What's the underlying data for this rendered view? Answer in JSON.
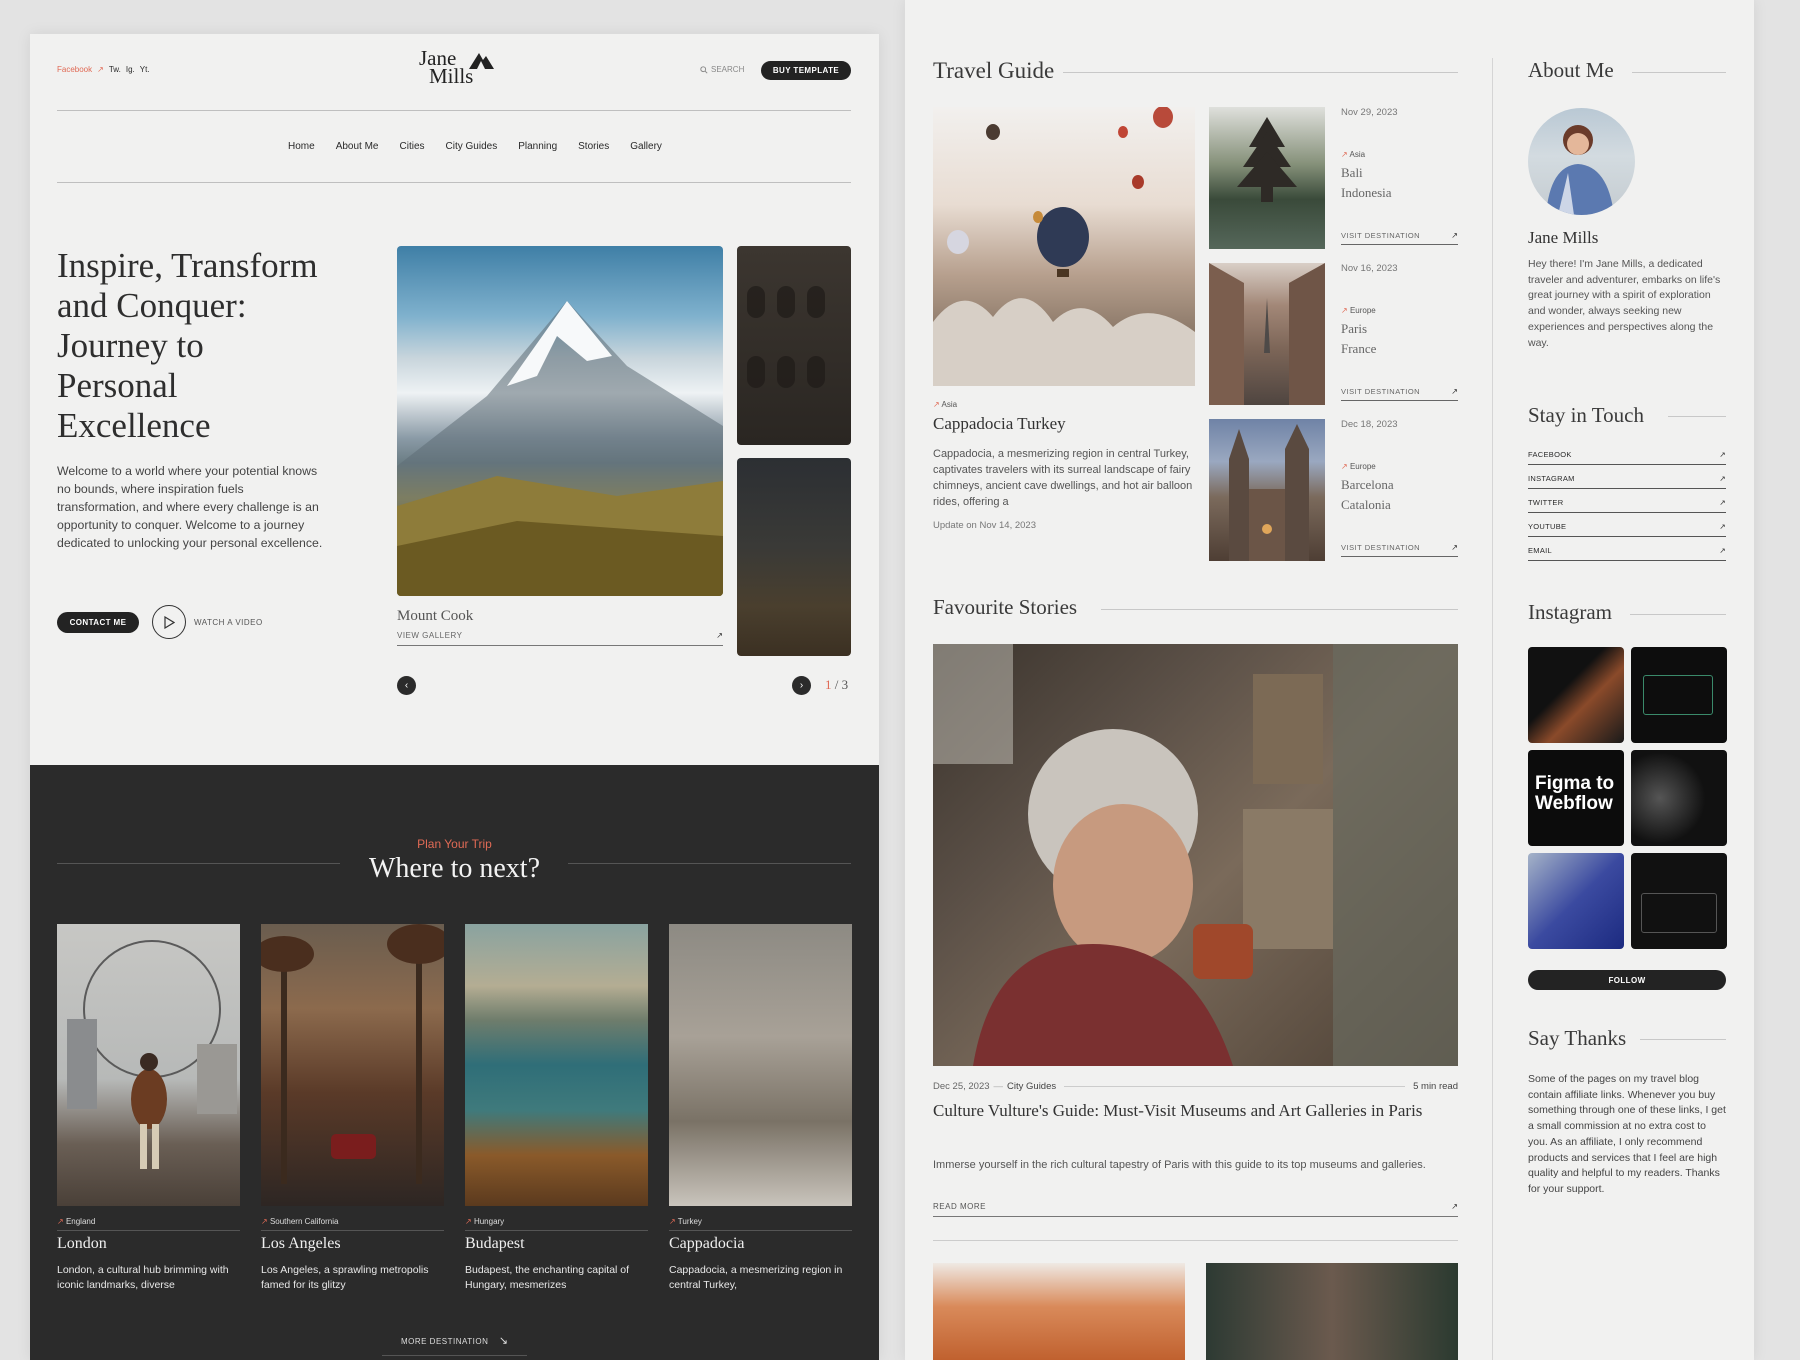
{
  "left": {
    "header": {
      "social": [
        "Facebook",
        "Tw.",
        "Ig.",
        "Yt."
      ],
      "logo_line1": "Jane",
      "logo_line2": "Mills",
      "search": "SEARCH",
      "buy": "BUY TEMPLATE"
    },
    "nav": [
      "Home",
      "About Me",
      "Cities",
      "City Guides",
      "Planning",
      "Stories",
      "Gallery"
    ],
    "hero": {
      "title_lines": [
        "Inspire, Transform",
        "and Conquer:",
        "Journey to",
        "Personal",
        "Excellence"
      ],
      "body": "Welcome to a world where your potential knows no bounds, where inspiration fuels transformation, and where every challenge is an opportunity to conquer. Welcome to a journey dedicated to unlocking your personal excellence.",
      "contact": "CONTACT ME",
      "watch": "WATCH A VIDEO",
      "caption": "Mount Cook",
      "gallery": "VIEW GALLERY",
      "page_current": "1",
      "page_sep": "/",
      "page_total": "3"
    },
    "trip": {
      "eyebrow": "Plan Your Trip",
      "title": "Where to next?",
      "cards": [
        {
          "region": "England",
          "city": "London",
          "desc": "London, a cultural hub brimming with iconic landmarks, diverse"
        },
        {
          "region": "Southern California",
          "city": "Los Angeles",
          "desc": "Los Angeles, a sprawling metropolis famed for its glitzy"
        },
        {
          "region": "Hungary",
          "city": "Budapest",
          "desc": "Budapest, the enchanting capital of Hungary, mesmerizes"
        },
        {
          "region": "Turkey",
          "city": "Cappadocia",
          "desc": "Cappadocia, a mesmerizing region in central Turkey,"
        }
      ],
      "more": "MORE DESTINATION"
    }
  },
  "right": {
    "guide": {
      "title": "Travel Guide",
      "main": {
        "region": "Asia",
        "title": "Cappadocia Turkey",
        "body": "Cappadocia, a mesmerizing region in central Turkey, captivates travelers with its surreal landscape of fairy chimneys, ancient cave dwellings, and hot air balloon rides, offering a",
        "update": "Update on Nov 14, 2023"
      },
      "items": [
        {
          "date": "Nov 29, 2023",
          "region": "Asia",
          "place": "Bali",
          "country": "Indonesia",
          "link": "VISIT DESTINATION"
        },
        {
          "date": "Nov 16, 2023",
          "region": "Europe",
          "place": "Paris",
          "country": "France",
          "link": "VISIT DESTINATION"
        },
        {
          "date": "Dec 18, 2023",
          "region": "Europe",
          "place": "Barcelona",
          "country": "Catalonia",
          "link": "VISIT DESTINATION"
        }
      ]
    },
    "stories": {
      "title": "Favourite Stories",
      "date": "Dec 25, 2023",
      "sep": "—",
      "category": "City Guides",
      "read_time": "5 min read",
      "headline": "Culture Vulture's Guide: Must-Visit Museums and Art Galleries in Paris",
      "excerpt": "Immerse yourself in the rich cultural tapestry of Paris with this guide to its top museums and galleries.",
      "read_more": "READ MORE"
    },
    "sidebar": {
      "about_title": "About Me",
      "name": "Jane Mills",
      "bio": "Hey there! I'm Jane Mills, a dedicated traveler and adventurer, embarks on life's great journey with a spirit of exploration and wonder, always seeking new experiences and perspectives along the way.",
      "touch_title": "Stay in Touch",
      "links": [
        "FACEBOOK",
        "INSTAGRAM",
        "TWITTER",
        "YOUTUBE",
        "EMAIL"
      ],
      "insta_title": "Instagram",
      "insta_tile_text_1": "Figma to",
      "insta_tile_text_2": "Webflow",
      "follow": "FOLLOW",
      "thanks_title": "Say Thanks",
      "thanks_body": "Some of the pages on my travel blog contain affiliate links. Whenever you buy something through one of these links, I get a small commission at no extra cost to you. As an affiliate, I only recommend products and services that I feel are high quality and helpful to my readers. Thanks for your support."
    }
  },
  "colors": {
    "accent": "#e06a55",
    "dark": "#2b2b2b",
    "panel": "#f1f1f0"
  },
  "icons": [
    "arrow-up-right-icon",
    "search-icon",
    "play-icon",
    "chevron-left-icon",
    "chevron-right-icon",
    "arrow-down-right-icon"
  ]
}
